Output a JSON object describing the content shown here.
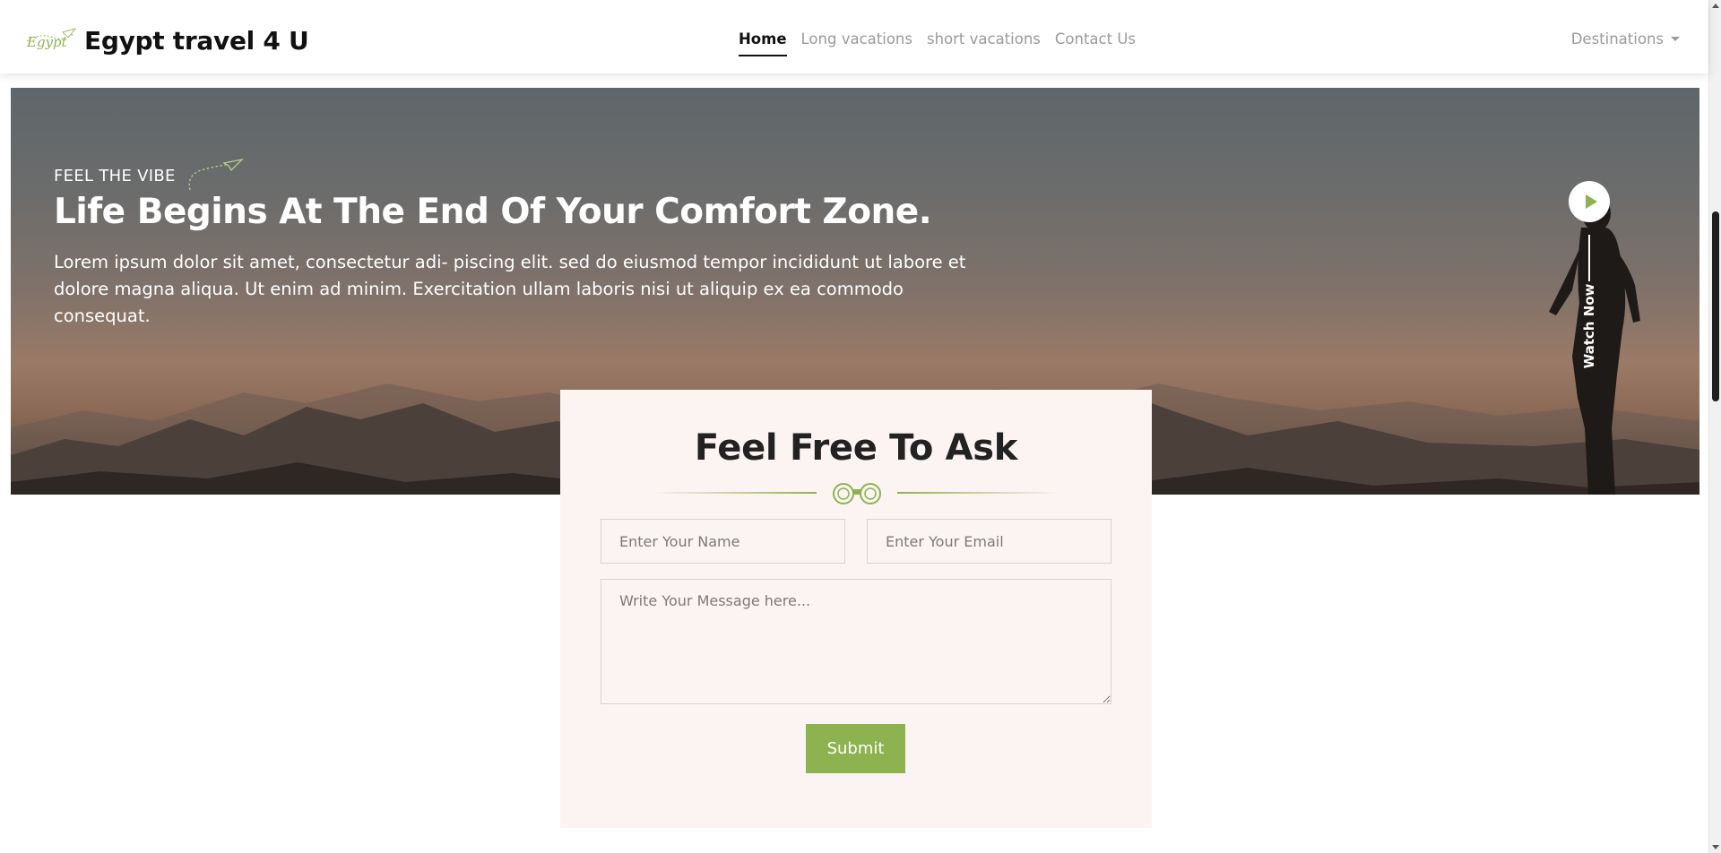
{
  "brand": {
    "name": "Egypt travel 4 U",
    "logo_text": "Egypt"
  },
  "nav": {
    "links": [
      {
        "label": "Home",
        "active": true
      },
      {
        "label": "Long vacations",
        "active": false
      },
      {
        "label": "short vacations",
        "active": false
      },
      {
        "label": "Contact Us",
        "active": false
      }
    ],
    "dropdown_label": "Destinations"
  },
  "hero": {
    "eyebrow": "FEEL THE VIBE",
    "title": "Life Begins At The End Of Your Comfort Zone.",
    "text": "Lorem ipsum dolor sit amet, consectetur adi- piscing elit. sed do eiusmod tempor incididunt ut labore et dolore magna aliqua. Ut enim ad minim. Exercitation ullam laboris nisi ut aliquip ex ea commodo consequat.",
    "watch_label": "Watch Now"
  },
  "contact": {
    "title": "Feel Free To Ask",
    "name_placeholder": "Enter Your Name",
    "email_placeholder": "Enter Your Email",
    "message_placeholder": "Write Your Message here...",
    "submit_label": "Submit"
  },
  "colors": {
    "accent": "#8cb34f",
    "card_bg": "#fcf4f2",
    "nav_active": "#111111",
    "nav_inactive": "#9a9a9a"
  },
  "icons": {
    "logo": "plane-logo-icon",
    "eyebrow": "paper-plane-icon",
    "divider": "binoculars-icon",
    "play": "play-icon",
    "dropdown": "caret-down-icon"
  }
}
